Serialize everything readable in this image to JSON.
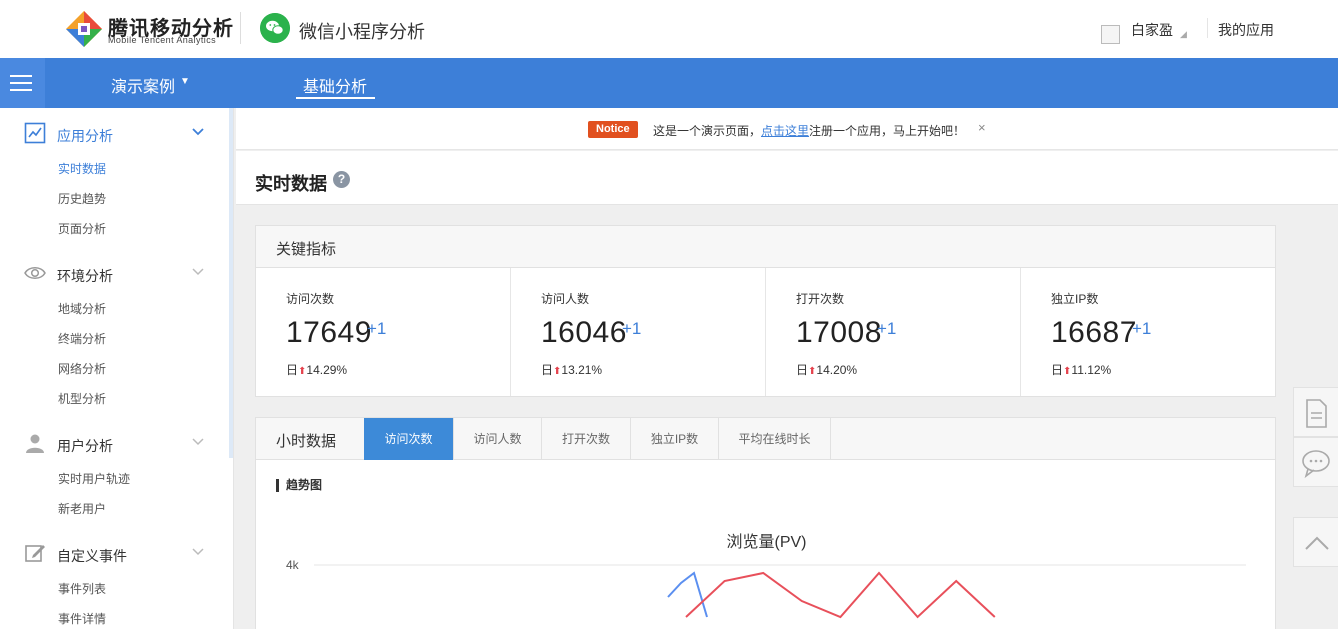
{
  "header": {
    "brand_title": "腾讯移动分析",
    "brand_subtitle": "Mobile Tencent Analytics",
    "product": "微信小程序分析",
    "user_name": "白家盈",
    "my_apps": "我的应用"
  },
  "nav": {
    "demo": "演示案例",
    "basic": "基础分析"
  },
  "sidebar": {
    "sections": [
      {
        "label": "应用分析",
        "icon": "line-chart-icon",
        "items": [
          "实时数据",
          "历史趋势",
          "页面分析"
        ]
      },
      {
        "label": "环境分析",
        "icon": "eye-icon",
        "items": [
          "地域分析",
          "终端分析",
          "网络分析",
          "机型分析"
        ]
      },
      {
        "label": "用户分析",
        "icon": "user-icon",
        "items": [
          "实时用户轨迹",
          "新老用户"
        ]
      },
      {
        "label": "自定义事件",
        "icon": "edit-icon",
        "items": [
          "事件列表",
          "事件详情"
        ]
      }
    ],
    "active_item": "实时数据"
  },
  "notice": {
    "badge": "Notice",
    "text_before": "这是一个演示页面，",
    "link": "点击这里",
    "text_after": "注册一个应用，马上开始吧！",
    "close": "×"
  },
  "page": {
    "title": "实时数据",
    "help": "?"
  },
  "metrics": {
    "title": "关键指标",
    "items": [
      {
        "label": "访问次数",
        "value": "17649",
        "delta": "+1",
        "rate_prefix": "日",
        "rate": "14.29%"
      },
      {
        "label": "访问人数",
        "value": "16046",
        "delta": "+1",
        "rate_prefix": "日",
        "rate": "13.21%"
      },
      {
        "label": "打开次数",
        "value": "17008",
        "delta": "+1",
        "rate_prefix": "日",
        "rate": "14.20%"
      },
      {
        "label": "独立IP数",
        "value": "16687",
        "delta": "+1",
        "rate_prefix": "日",
        "rate": "11.12%"
      }
    ]
  },
  "hourly": {
    "title": "小时数据",
    "tabs": [
      "访问次数",
      "访问人数",
      "打开次数",
      "独立IP数",
      "平均在线时长"
    ],
    "active_tab": 0,
    "trend_title": "趋势图"
  },
  "chart_data": {
    "type": "line",
    "title": "浏览量(PV)",
    "y_tick_labels": [
      "4k"
    ],
    "ylim": [
      0,
      4000
    ],
    "colors": {
      "series_a": "#5b8ff0",
      "series_b": "#e8505b"
    },
    "series": [
      {
        "values": [
          3200,
          3550,
          3800,
          2700
        ]
      },
      {
        "values": [
          2700,
          3600,
          3800,
          3100,
          2700,
          3800,
          2700,
          3600,
          2700
        ]
      }
    ]
  },
  "colors": {
    "accent": "#3d7fd8",
    "notice": "#e1501f",
    "up": "#e5424d"
  }
}
